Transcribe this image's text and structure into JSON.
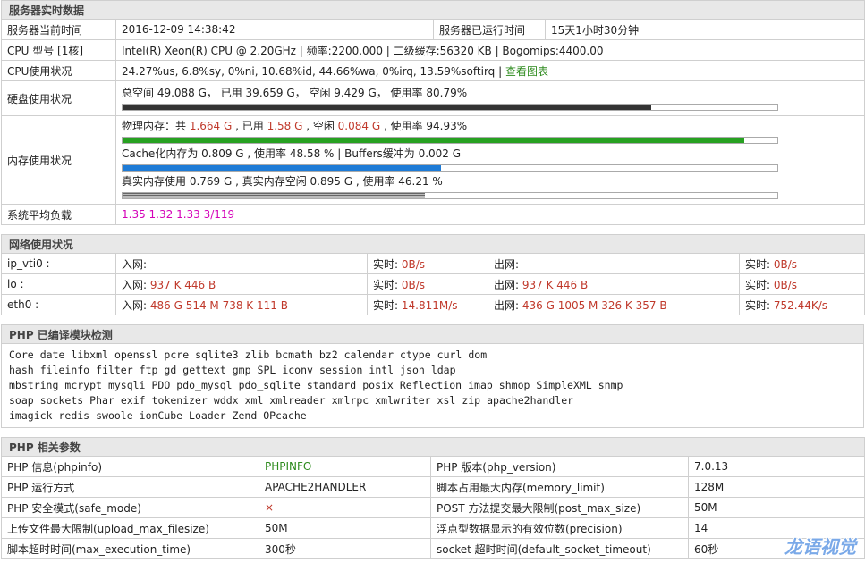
{
  "server": {
    "title": "服务器实时数据",
    "time_label": "服务器当前时间",
    "time_value": "2016-12-09 14:38:42",
    "uptime_label": "服务器已运行时间",
    "uptime_value": "15天1小时30分钟",
    "cpu_model_label": "CPU 型号 [1核]",
    "cpu_model_value": "Intel(R) Xeon(R) CPU @ 2.20GHz | 频率:2200.000 | 二级缓存:56320 KB | Bogomips:4400.00",
    "cpu_usage_label": "CPU使用状况",
    "cpu_usage_value": "24.27%us, 6.8%sy, 0%ni, 10.68%id, 44.66%wa, 0%irq, 13.59%softirq | ",
    "cpu_chart_link": "查看图表",
    "disk_label": "硬盘使用状况",
    "disk_text": "总空间 49.088 G， 已用 39.659 G， 空闲 9.429 G， 使用率 80.79%",
    "disk_pct": 80.79,
    "mem_label": "内存使用状况",
    "mem_phys_prefix": "物理内存：共 ",
    "mem_phys_total": "1.664 G",
    "mem_phys_used_prefix": " , 已用 ",
    "mem_phys_used": "1.58 G",
    "mem_phys_free_prefix": " , 空闲 ",
    "mem_phys_free": "0.084 G",
    "mem_phys_suffix": " , 使用率 94.93%",
    "mem_phys_pct": 94.93,
    "mem_cache_text": "Cache化内存为 0.809 G , 使用率 48.58 % | Buffers缓冲为 0.002 G",
    "mem_cache_pct": 48.58,
    "mem_real_text": "真实内存使用 0.769 G , 真实内存空闲 0.895 G , 使用率 46.21 %",
    "mem_real_pct": 46.21,
    "load_label": "系统平均负载",
    "load_value": "1.35 1.32 1.33 3/119"
  },
  "network": {
    "title": "网络使用状况",
    "in_label": "入网: ",
    "out_label": "出网: ",
    "rt_label": "实时: ",
    "rows": [
      {
        "name": "ip_vti0 :",
        "in": "",
        "in_rt": "0B/s",
        "out": "",
        "out_rt": "0B/s"
      },
      {
        "name": "lo :",
        "in": "937 K 446 B",
        "in_rt": "0B/s",
        "out": "937 K 446 B",
        "out_rt": "0B/s"
      },
      {
        "name": "eth0 :",
        "in": "486 G 514 M 738 K 111 B",
        "in_rt": "14.811M/s",
        "out": "436 G 1005 M 326 K 357 B",
        "out_rt": "752.44K/s"
      }
    ]
  },
  "modules": {
    "title": "PHP 已编译模块检测",
    "lines": [
      [
        "Core",
        "date",
        "libxml",
        "openssl",
        "pcre",
        "sqlite3",
        "zlib",
        "bcmath",
        "bz2",
        "calendar",
        "ctype",
        "curl",
        "dom"
      ],
      [
        "hash",
        "fileinfo",
        "filter",
        "ftp",
        "gd",
        "gettext",
        "gmp",
        "SPL",
        "iconv",
        "session",
        "intl",
        "json",
        "ldap"
      ],
      [
        "mbstring",
        "mcrypt",
        "mysqli",
        "PDO",
        "pdo_mysql",
        "pdo_sqlite",
        "standard",
        "posix",
        "Reflection",
        "imap",
        "shmop",
        "SimpleXML",
        "snmp"
      ],
      [
        "soap",
        "sockets",
        "Phar",
        "exif",
        "tokenizer",
        "wddx",
        "xml",
        "xmlreader",
        "xmlrpc",
        "xmlwriter",
        "xsl",
        "zip",
        "apache2handler"
      ],
      [
        "imagick",
        "redis",
        "swoole",
        "ionCube Loader",
        "Zend OPcache"
      ]
    ]
  },
  "params": {
    "title": "PHP 相关参数",
    "rows": [
      {
        "l1": "PHP 信息(phpinfo)",
        "v1": "PHPINFO",
        "l2": "PHP 版本(php_version)",
        "v2": "7.0.13"
      },
      {
        "l1": "PHP 运行方式",
        "v1": "APACHE2HANDLER",
        "l2": "脚本占用最大内存(memory_limit)",
        "v2": "128M"
      },
      {
        "l1": "PHP 安全模式(safe_mode)",
        "v1": "×",
        "l2": "POST 方法提交最大限制(post_max_size)",
        "v2": "50M"
      },
      {
        "l1": "上传文件最大限制(upload_max_filesize)",
        "v1": "50M",
        "l2": "浮点型数据显示的有效位数(precision)",
        "v2": "14"
      },
      {
        "l1": "脚本超时时间(max_execution_time)",
        "v1": "300秒",
        "l2": "socket 超时时间(default_socket_timeout)",
        "v2": "60秒"
      }
    ]
  },
  "watermark": "龙语视觉",
  "colors": {
    "header_bg": "#e8e8e8",
    "red": "#c0392b",
    "green": "#27a121",
    "blue": "#1e7bd6",
    "pink": "#d400b8"
  }
}
